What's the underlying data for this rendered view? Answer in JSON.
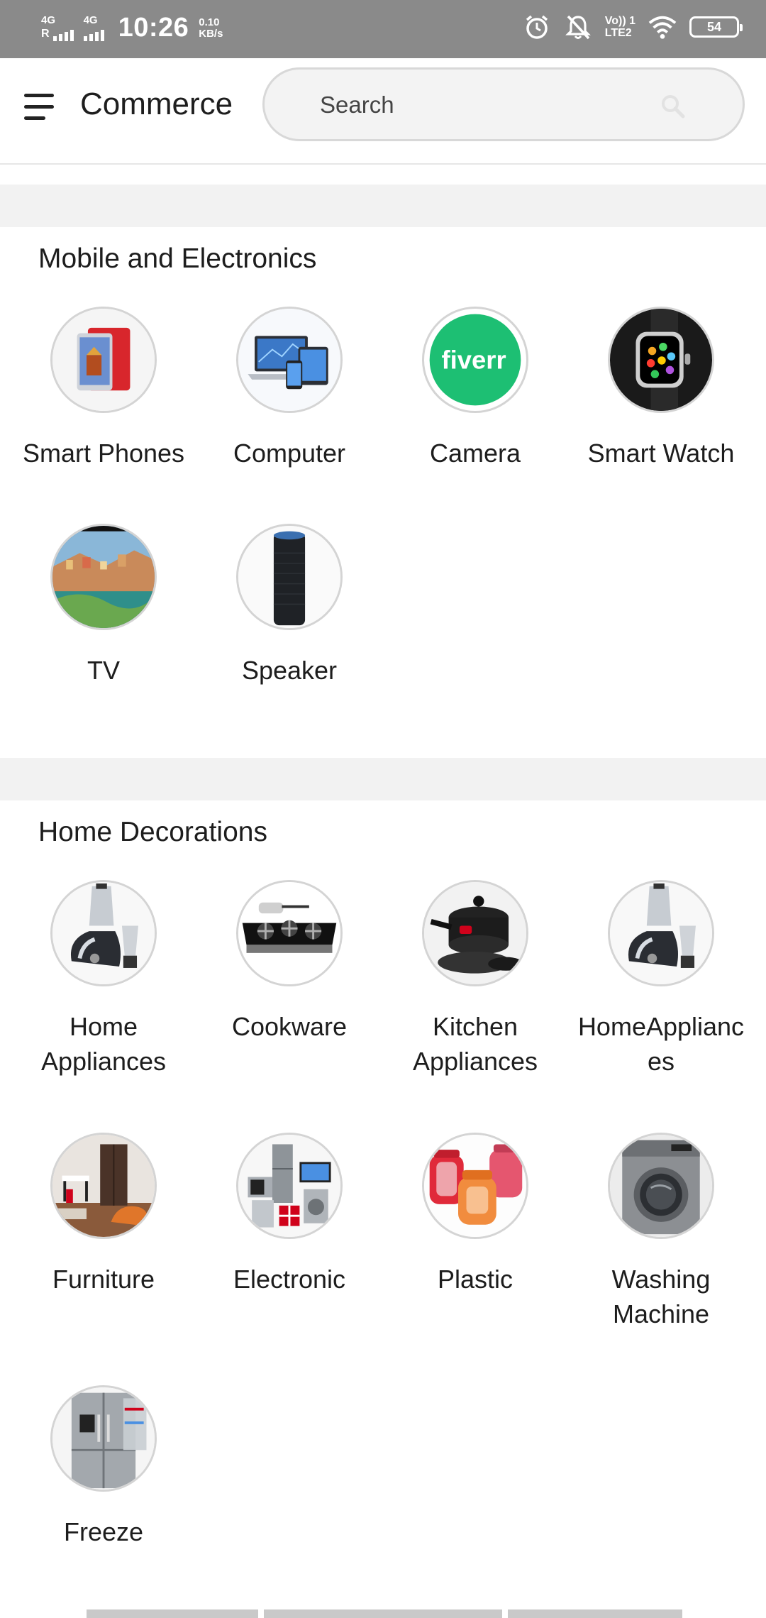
{
  "status_bar": {
    "sim1_network": "4G",
    "sim1_roaming": "R",
    "sim2_network": "4G",
    "time": "10:26",
    "speed_value": "0.10",
    "speed_unit": "KB/s",
    "volte_line1": "Vo)) 1",
    "volte_line2": "LTE2",
    "battery": "54",
    "icons": [
      "alarm-icon",
      "bell-off-icon",
      "wifi-icon",
      "battery-icon"
    ]
  },
  "app_bar": {
    "title": "Commerce",
    "search_placeholder": "Search",
    "icons": [
      "menu-icon",
      "search-icon"
    ]
  },
  "sections": [
    {
      "title": "Mobile and Electronics",
      "items": [
        {
          "label": "Smart Phones",
          "image": "smartphone-image"
        },
        {
          "label": "Computer",
          "image": "computer-image"
        },
        {
          "label": "Camera",
          "image": "fiverr-logo",
          "logo_text": "fiverr",
          "logo_color": "#1dbf73"
        },
        {
          "label": "Smart Watch",
          "image": "smartwatch-image"
        },
        {
          "label": "TV",
          "image": "tv-image"
        },
        {
          "label": "Speaker",
          "image": "speaker-image"
        }
      ]
    },
    {
      "title": "Home Decorations",
      "items": [
        {
          "label": "Home Appliances",
          "image": "mixer-image"
        },
        {
          "label": "Cookware",
          "image": "gas-stove-image"
        },
        {
          "label": "Kitchen Appliances",
          "image": "cookware-set-image"
        },
        {
          "label": "HomeAppliances",
          "image": "mixer-image"
        },
        {
          "label": "Furniture",
          "image": "furniture-room-image"
        },
        {
          "label": "Electronic",
          "image": "electronics-image"
        },
        {
          "label": "Plastic",
          "image": "plastic-containers-image"
        },
        {
          "label": "Washing Machine",
          "image": "washing-machine-image"
        },
        {
          "label": "Freeze",
          "image": "fridge-image"
        }
      ]
    }
  ],
  "colors": {
    "status_bar_bg": "#8a8a8a",
    "band_bg": "#f2f2f2",
    "text": "#1d1d1d",
    "circle_border": "#d4d4d4"
  }
}
